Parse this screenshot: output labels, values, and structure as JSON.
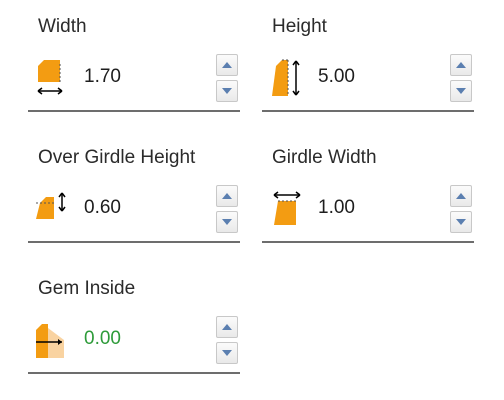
{
  "fields": [
    {
      "label": "Width",
      "value": "1.70",
      "icon": "width-icon"
    },
    {
      "label": "Height",
      "value": "5.00",
      "icon": "height-icon"
    },
    {
      "label": "Over Girdle Height",
      "value": "0.60",
      "icon": "over-girdle-height-icon"
    },
    {
      "label": "Girdle Width",
      "value": "1.00",
      "icon": "girdle-width-icon"
    },
    {
      "label": "Gem Inside",
      "value": "0.00",
      "icon": "gem-inside-icon"
    }
  ],
  "colors": {
    "icon_orange": "#f39c12",
    "value_green": "#2e9b3a",
    "spin_arrow": "#5b7fb0"
  }
}
